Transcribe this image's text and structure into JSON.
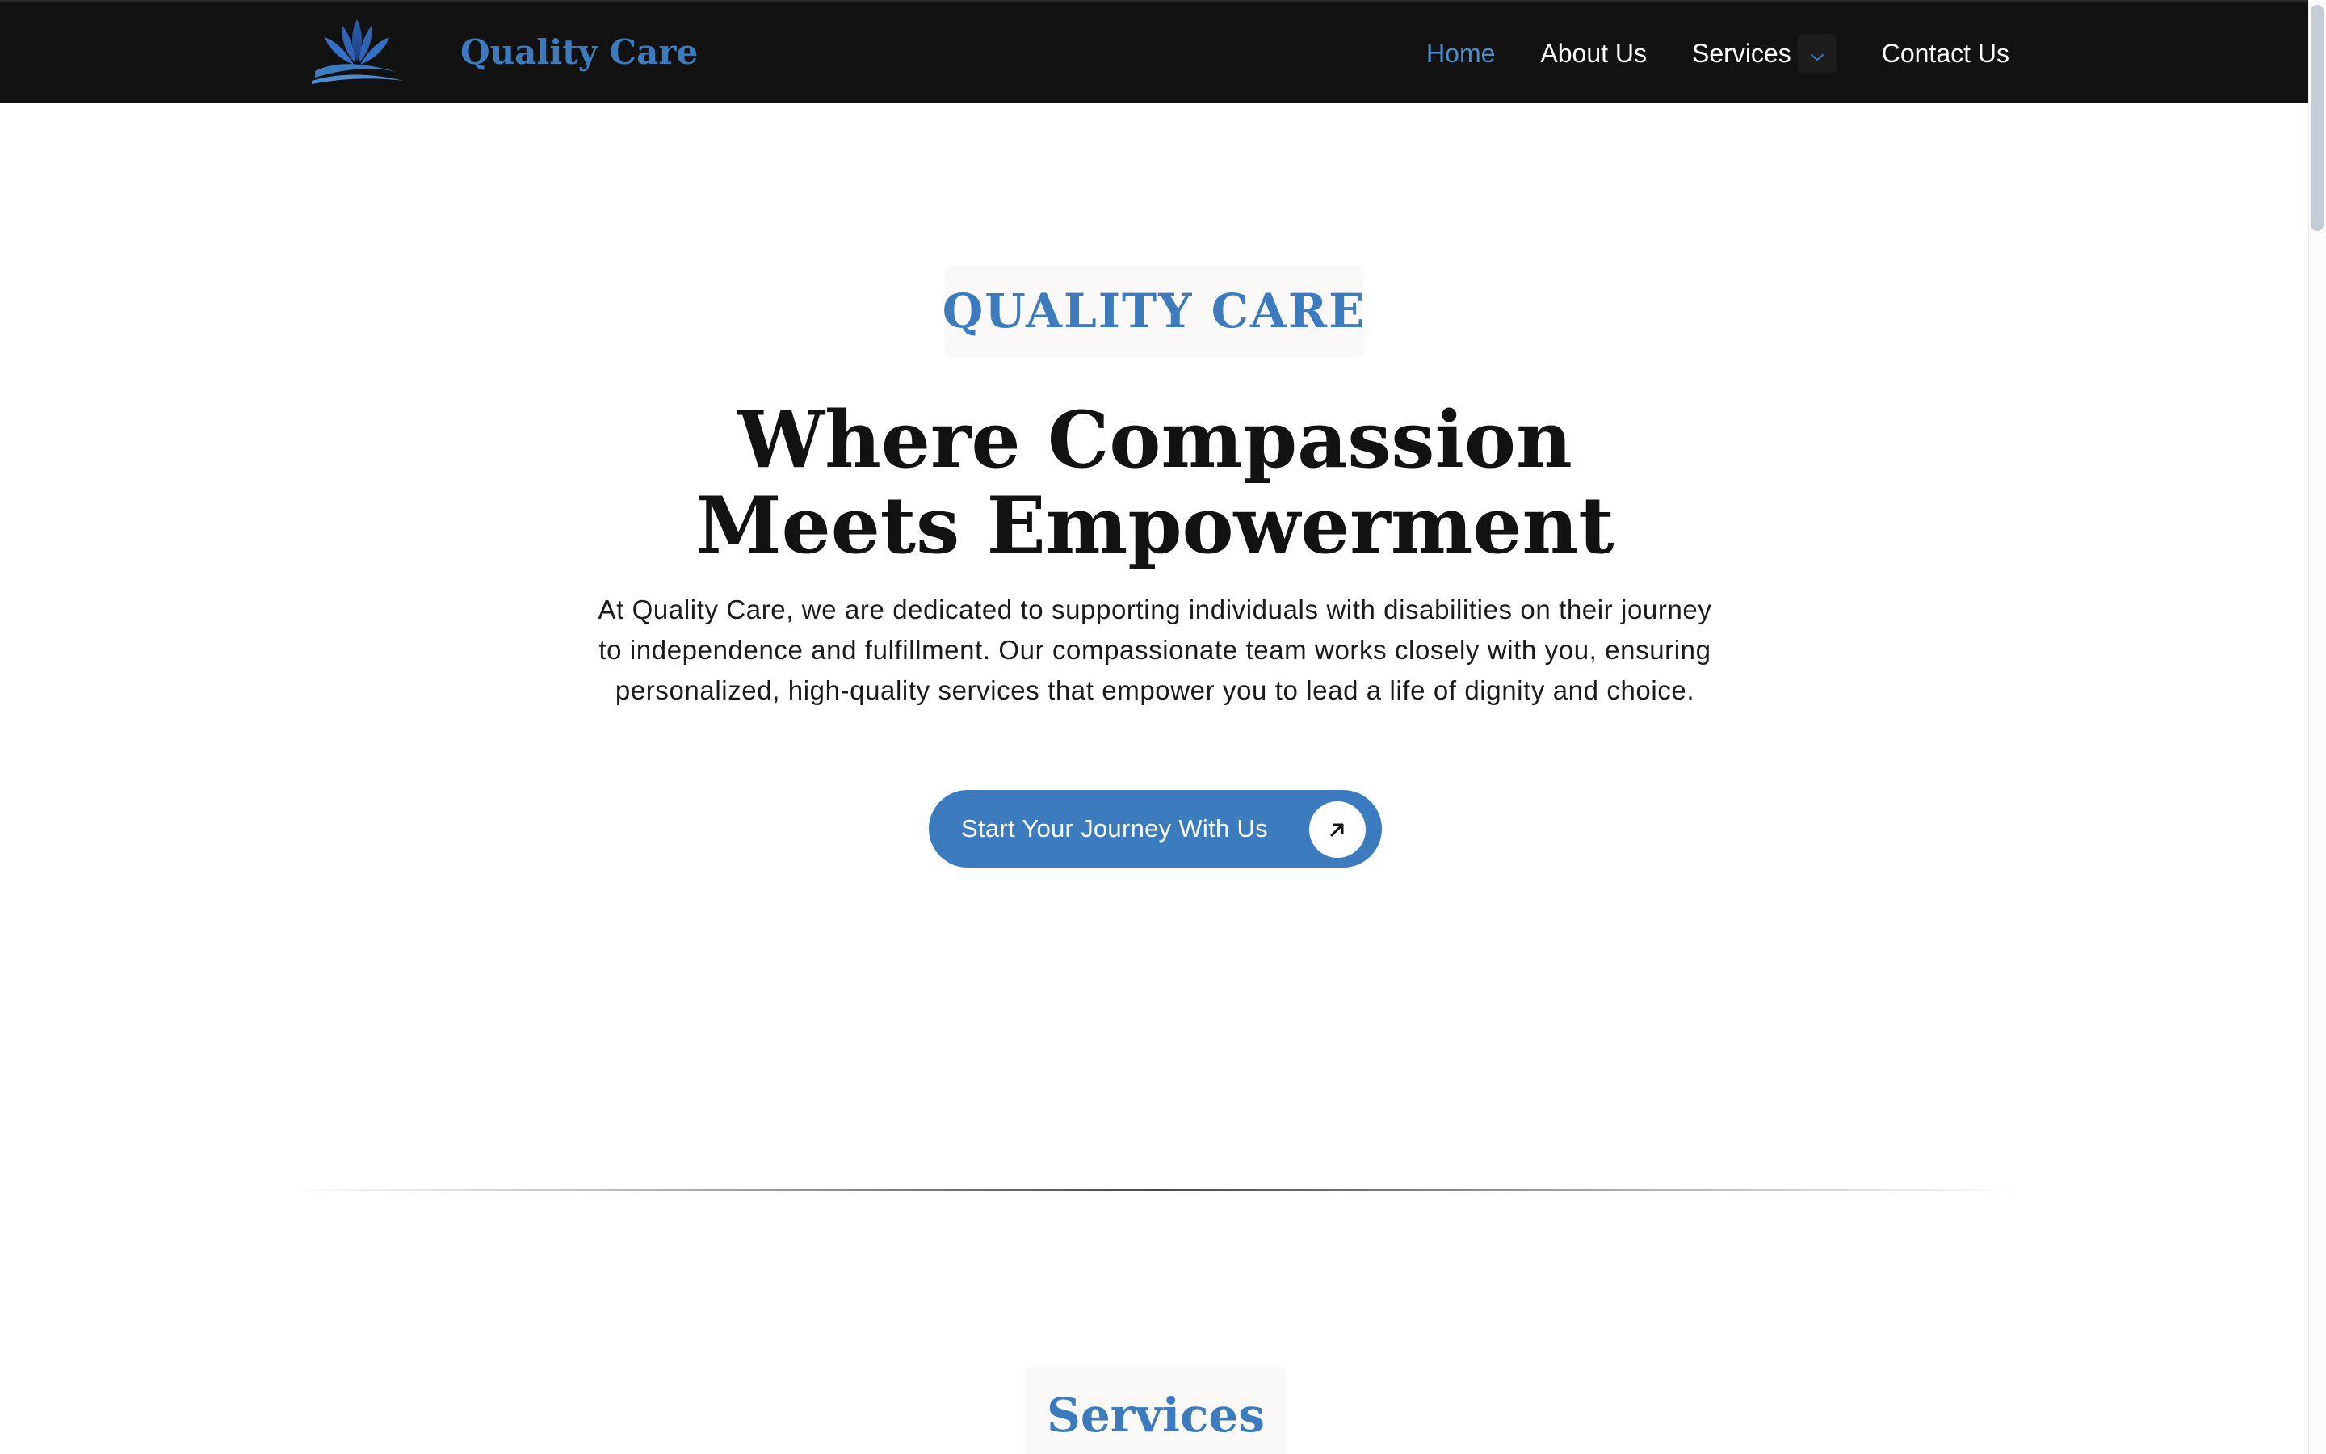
{
  "header": {
    "logo_icon": "lotus-icon",
    "brand_name": "Quality Care",
    "nav": {
      "home": "Home",
      "about": "About Us",
      "services": "Services",
      "services_toggle_icon": "chevron-down-icon",
      "contact": "Contact Us"
    },
    "active_item": "Home"
  },
  "hero": {
    "eyebrow": "QUALITY CARE",
    "title_line_1": "Where Compassion",
    "title_line_2": "Meets Empowerment",
    "description": "At Quality Care, we are dedicated to supporting individuals with disabilities on their journey to independence and fulfillment. Our compassionate team works closely with you, ensuring personalized, high-quality services that empower you to lead a life of dignity and choice.",
    "cta_label": "Start Your Journey With Us",
    "cta_icon": "arrow-up-right-icon"
  },
  "services_section": {
    "heading": "Services"
  },
  "colors": {
    "brand_blue": "#3c7bbd",
    "active_nav": "#4b8ed0",
    "nav_background": "#121212",
    "heading_text": "#121212",
    "tag_background": "#faf9f7"
  }
}
